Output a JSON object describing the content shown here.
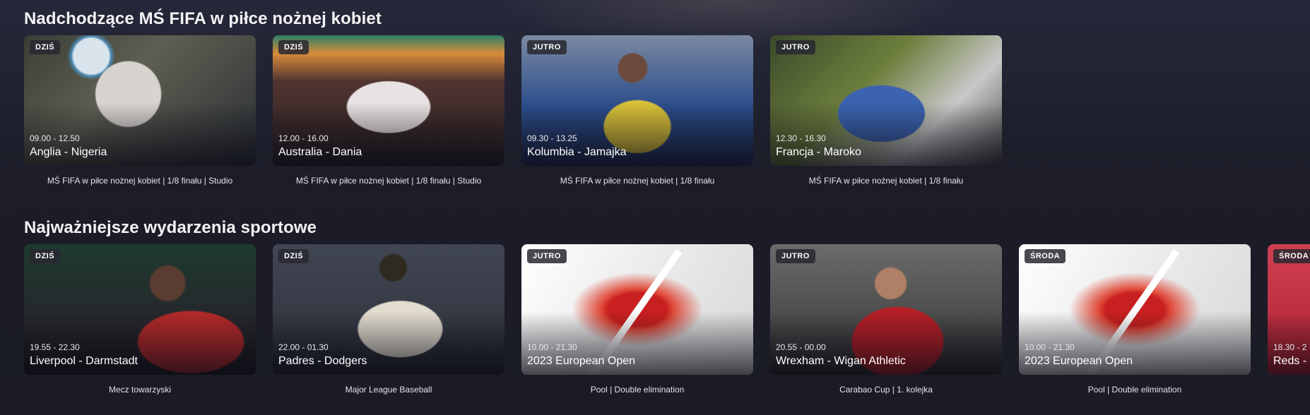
{
  "sections": [
    {
      "title": "Nadchodzące MŚ FIFA w piłce nożnej kobiet",
      "cards": [
        {
          "badge": "DZIŚ",
          "time": "09.00 - 12.50",
          "match": "Anglia - Nigeria",
          "caption": "MŚ FIFA w piłce nożnej kobiet | 1/8 finału | Studio"
        },
        {
          "badge": "DZIŚ",
          "time": "12.00 - 16.00",
          "match": "Australia - Dania",
          "caption": "MŚ FIFA w piłce nożnej kobiet | 1/8 finału | Studio"
        },
        {
          "badge": "JUTRO",
          "time": "09.30 - 13.25",
          "match": "Kolumbia - Jamajka",
          "caption": "MŚ FIFA w piłce nożnej kobiet | 1/8 finału"
        },
        {
          "badge": "JUTRO",
          "time": "12.30 - 16.30",
          "match": "Francja - Maroko",
          "caption": "MŚ FIFA w piłce nożnej kobiet | 1/8 finału"
        }
      ]
    },
    {
      "title": "Najważniejsze wydarzenia sportowe",
      "cards": [
        {
          "badge": "DZIŚ",
          "time": "19.55 - 22.30",
          "match": "Liverpool - Darmstadt",
          "caption": "Mecz towarzyski"
        },
        {
          "badge": "DZIŚ",
          "time": "22.00 - 01.30",
          "match": "Padres - Dodgers",
          "caption": "Major League Baseball"
        },
        {
          "badge": "JUTRO",
          "time": "10.00 - 21.30",
          "match": "2023 European Open",
          "caption": "Pool | Double elimination"
        },
        {
          "badge": "JUTRO",
          "time": "20.55 - 00.00",
          "match": "Wrexham - Wigan Athletic",
          "caption": "Carabao Cup | 1. kolejka"
        },
        {
          "badge": "ŚRODA",
          "time": "10.00 - 21.30",
          "match": "2023 European Open",
          "caption": "Pool | Double elimination"
        },
        {
          "badge": "ŚRODA",
          "time": "18.30 - 2",
          "match": "Reds - ",
          "caption": ""
        }
      ]
    }
  ]
}
